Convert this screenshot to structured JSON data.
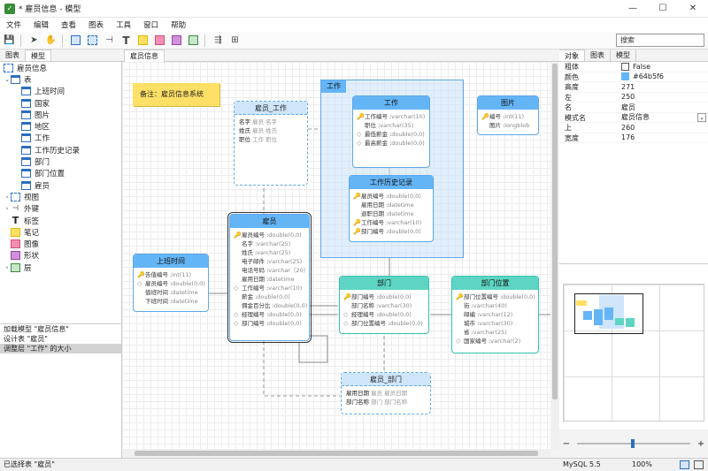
{
  "window": {
    "title": "* 雇员信息 - 模型",
    "min": "—",
    "max": "☐",
    "close": "✕"
  },
  "menu": [
    "文件",
    "编辑",
    "查看",
    "图表",
    "工具",
    "窗口",
    "帮助"
  ],
  "search": {
    "placeholder": "搜索"
  },
  "left_tabs": [
    "图表",
    "模型"
  ],
  "tree": {
    "top": "雇员信息",
    "tables_group": "表",
    "tables": [
      "上班时间",
      "国家",
      "图片",
      "地区",
      "工作",
      "工作历史记录",
      "部门",
      "部门位置",
      "雇员"
    ],
    "groups": [
      "视图",
      "外键",
      "标签",
      "笔记",
      "图像",
      "形状",
      "层"
    ]
  },
  "log": [
    "加载模型 \"雇员信息\"",
    "设计表 \"雇员\"",
    "调整层 \"工作\" 的大小"
  ],
  "canvas_tab": "雇员信息",
  "note": "备注：雇员信息系统",
  "layer": "工作",
  "entities": {
    "work": {
      "title": "工作",
      "rows": [
        [
          "k",
          "工作编号 : ",
          "varchar(10)"
        ],
        [
          "",
          "职位 : ",
          "varchar(35)"
        ],
        [
          "d",
          "最低薪金 : ",
          "double(0,0)"
        ],
        [
          "d",
          "最高薪金 : ",
          "double(0,0)"
        ]
      ]
    },
    "picture": {
      "title": "图片",
      "rows": [
        [
          "k",
          "编号 : ",
          "int(11)"
        ],
        [
          "",
          "图片 : ",
          "longblob"
        ]
      ]
    },
    "history": {
      "title": "工作历史记录",
      "rows": [
        [
          "k",
          "雇员编号 : ",
          "double(0,0)"
        ],
        [
          "",
          "雇用日期 : ",
          "datetime"
        ],
        [
          "",
          "退职日期 : ",
          "datetime"
        ],
        [
          "k",
          "工作编号 : ",
          "varchar(10)"
        ],
        [
          "k",
          "部门编号 : ",
          "double(0,0)"
        ]
      ]
    },
    "employee": {
      "title": "雇员",
      "rows": [
        [
          "k",
          "雇员编号 : ",
          "double(0,0)"
        ],
        [
          "",
          "名字 : ",
          "varchar(25)"
        ],
        [
          "",
          "姓氏 : ",
          "varchar(25)"
        ],
        [
          "",
          "电子邮件 : ",
          "varchar(25)"
        ],
        [
          "",
          "电话号码 : ",
          "varchar（20）"
        ],
        [
          "",
          "雇用日期 : ",
          "datetime"
        ],
        [
          "d",
          "工作编号 : ",
          "varchar(10)"
        ],
        [
          "",
          "薪金 : ",
          "double(0,0)"
        ],
        [
          "",
          "佣金百分比 : ",
          "double(0,0)"
        ],
        [
          "d",
          "经理编号 : ",
          "double(0,0)"
        ],
        [
          "d",
          "部门编号 : ",
          "double(0,0)"
        ]
      ]
    },
    "worktime": {
      "title": "上班时间",
      "rows": [
        [
          "k",
          "告值编号 : ",
          "int(11)"
        ],
        [
          "d",
          "雇员编号 : ",
          "double(0,0)"
        ],
        [
          "",
          "值班时间 : ",
          "datetime"
        ],
        [
          "",
          "下班时间 : ",
          "datetime"
        ]
      ]
    },
    "dept": {
      "title": "部门",
      "rows": [
        [
          "k",
          "部门编号 : ",
          "double(0,0)"
        ],
        [
          "",
          "部门名称 : ",
          "varchar(30)"
        ],
        [
          "d",
          "经理编号 : ",
          "double(0,0)"
        ],
        [
          "d",
          "部门位置编号 : ",
          "double(0,0)"
        ]
      ]
    },
    "deptloc": {
      "title": "部门位置",
      "rows": [
        [
          "k",
          "部门位置编号 : ",
          "double(0,0)"
        ],
        [
          "",
          "街 : ",
          "varchar(40)"
        ],
        [
          "",
          "邮编 : ",
          "varchar(12)"
        ],
        [
          "",
          "城市 : ",
          "varchar(30)"
        ],
        [
          "",
          "省 : ",
          "varchar(25)"
        ],
        [
          "d",
          "国家编号 : ",
          "varchar(2)"
        ]
      ]
    }
  },
  "views": {
    "emp_work": {
      "title": "雇员_工作",
      "rows": [
        [
          "名字",
          "雇员",
          "名字"
        ],
        [
          "姓氏",
          "雇员",
          "姓氏"
        ],
        [
          "职位",
          "工作",
          "职位"
        ]
      ]
    },
    "emp_dept": {
      "title": "雇员_部门",
      "rows": [
        [
          "雇用日期",
          "雇员",
          "雇员日期"
        ],
        [
          "部门名称",
          "部门",
          "部门名称"
        ]
      ]
    }
  },
  "right_tabs": [
    "对象",
    "图表",
    "模型"
  ],
  "properties": [
    {
      "k": "粗体",
      "v": "False",
      "check": true
    },
    {
      "k": "颜色",
      "v": "#64b5f6",
      "swatch": "#64b5f6"
    },
    {
      "k": "高度",
      "v": "271"
    },
    {
      "k": "左",
      "v": "250"
    },
    {
      "k": "名",
      "v": "雇员"
    },
    {
      "k": "模式名",
      "v": "雇员信息",
      "dropdown": true
    },
    {
      "k": "上",
      "v": "260"
    },
    {
      "k": "宽度",
      "v": "176"
    }
  ],
  "status": {
    "left": "已选择表 \"雇员\"",
    "db": "MySQL 5.5",
    "zoom": "100%"
  },
  "colors": {
    "blue": "#64b5f6",
    "teal": "#5ed5c4",
    "note": "#ffe066"
  }
}
